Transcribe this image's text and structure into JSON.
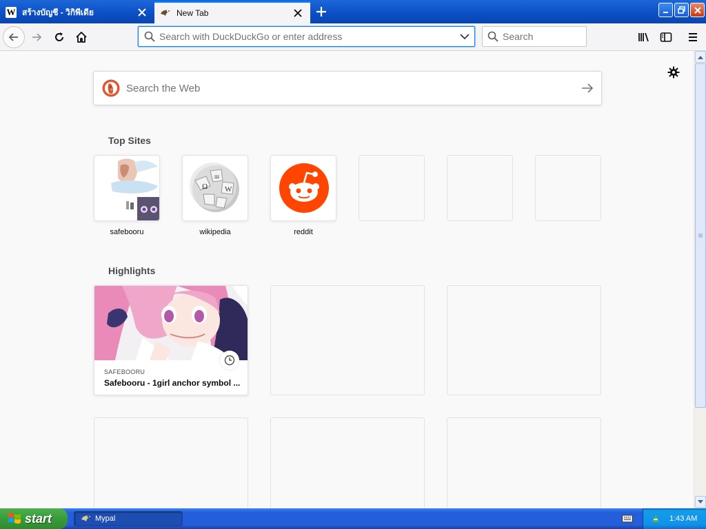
{
  "tabs": [
    {
      "title": "สร้างบัญชี - วิกิพีเดีย",
      "favicon": "wikipedia-w-icon",
      "active": false
    },
    {
      "title": "New Tab",
      "favicon": "mypal-icon",
      "active": true
    }
  ],
  "navbar": {
    "url_placeholder": "Search with DuckDuckGo or enter address",
    "search_placeholder": "Search"
  },
  "newtab": {
    "web_search_placeholder": "Search the Web",
    "top_sites_title": "Top Sites",
    "top_sites": [
      {
        "label": "safebooru"
      },
      {
        "label": "wikipedia"
      },
      {
        "label": "reddit"
      }
    ],
    "highlights_title": "Highlights",
    "highlights": [
      {
        "host": "SAFEBOORU",
        "title": "Safebooru - 1girl anchor symbol ..."
      }
    ]
  },
  "taskbar": {
    "start_label": "start",
    "task_label": "Mypal",
    "clock": "1:43 AM"
  },
  "colors": {
    "accent": "#0a84ff",
    "reddit": "#ff4500",
    "xp_blue": "#245edb",
    "xp_green": "#3a9b3a"
  }
}
